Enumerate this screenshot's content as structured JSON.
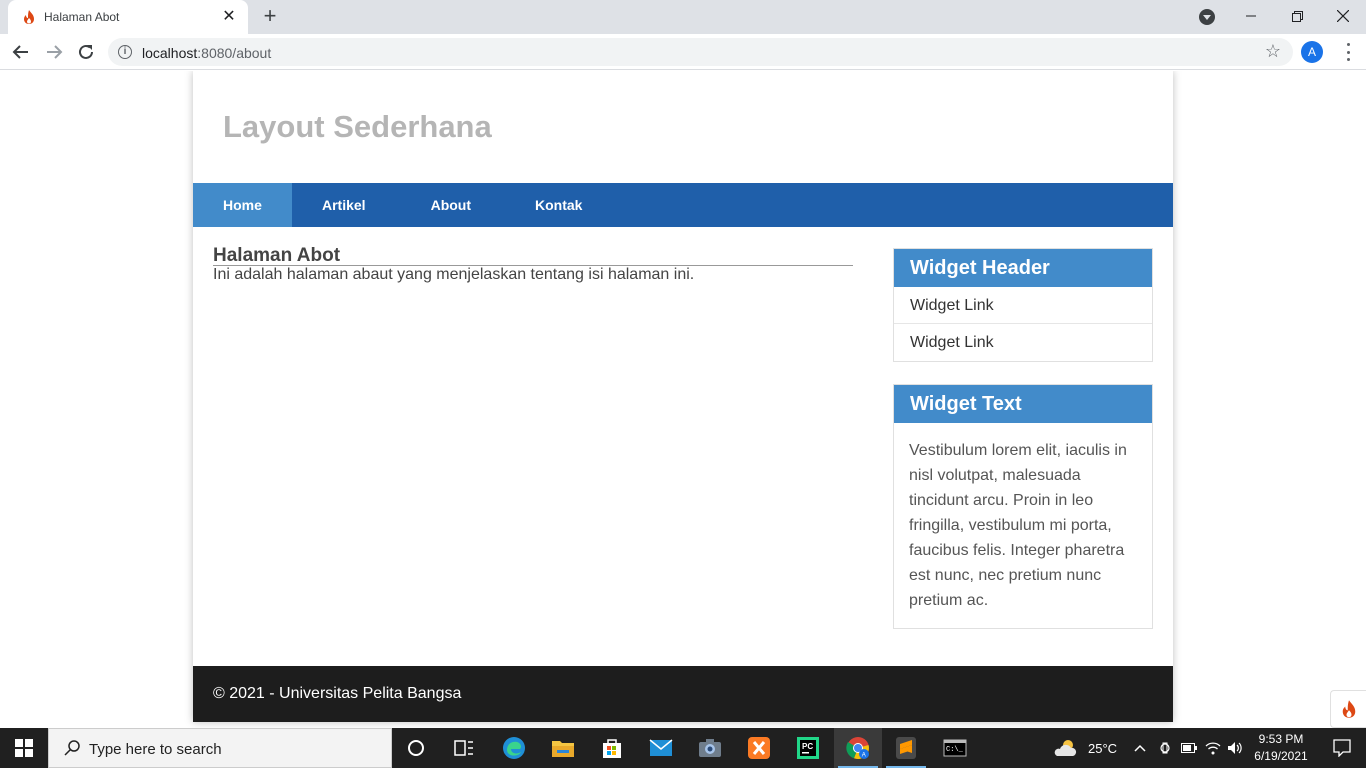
{
  "browser": {
    "tab_title": "Halaman Abot",
    "url_host": "localhost",
    "url_rest": ":8080/about",
    "profile_initial": "A"
  },
  "site": {
    "title": "Layout Sederhana",
    "nav": [
      "Home",
      "Artikel",
      "About",
      "Kontak"
    ],
    "active_nav": "Home",
    "page_heading": "Halaman Abot",
    "page_text": "Ini adalah halaman abaut yang menjelaskan tentang isi halaman ini.",
    "widget1": {
      "header": "Widget Header",
      "links": [
        "Widget Link",
        "Widget Link"
      ]
    },
    "widget2": {
      "header": "Widget Text",
      "text": "Vestibulum lorem elit, iaculis in nisl volutpat, malesuada tincidunt arcu. Proin in leo fringilla, vestibulum mi porta, faucibus felis. Integer pharetra est nunc, nec pretium nunc pretium ac."
    },
    "footer": "© 2021 - Universitas Pelita Bangsa"
  },
  "taskbar": {
    "search_placeholder": "Type here to search",
    "weather_temp": "25°C",
    "time": "9:53 PM",
    "date": "6/19/2021"
  },
  "colors": {
    "nav_bar": "#1f5faa",
    "nav_active": "#428bca",
    "widget_header": "#428bca",
    "footer": "#1d1d1d",
    "site_title": "#b5b5b5"
  }
}
